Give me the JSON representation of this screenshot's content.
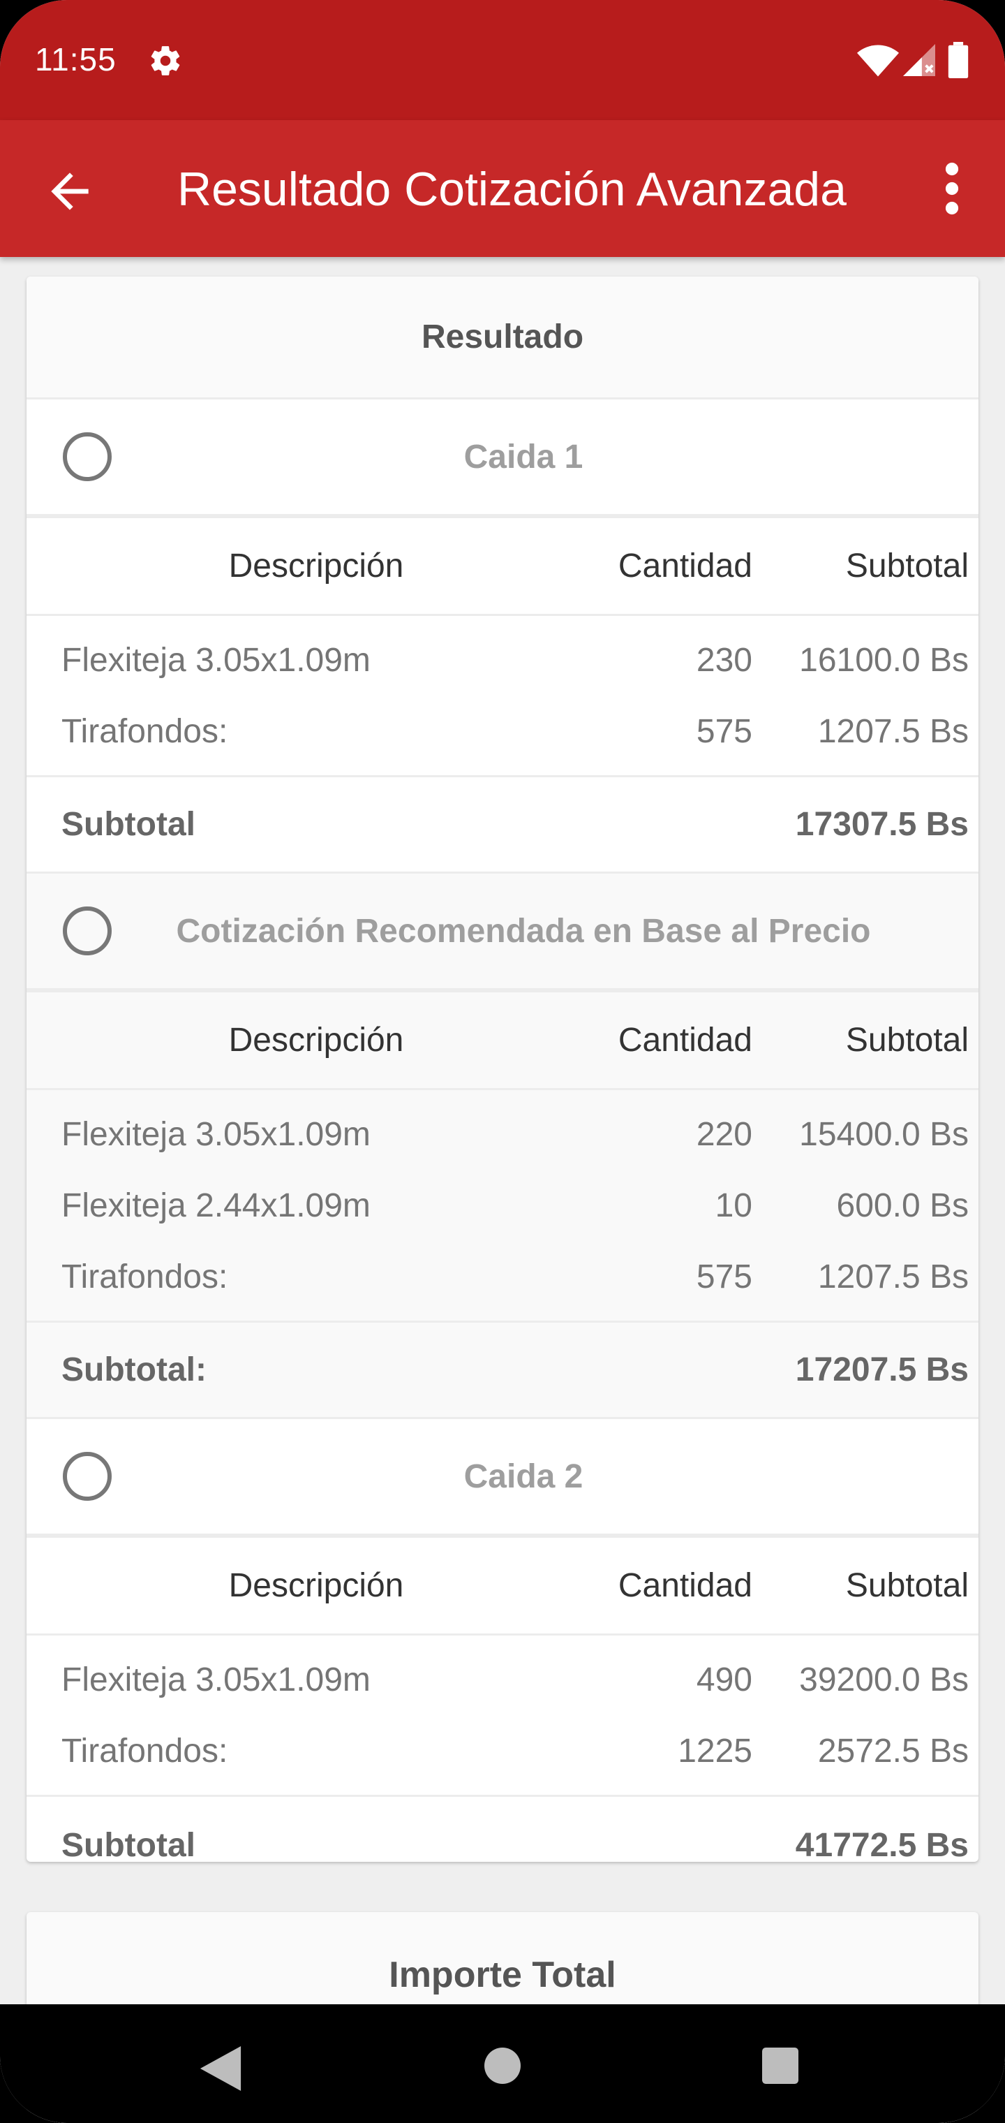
{
  "status_bar": {
    "time": "11:55"
  },
  "app_bar": {
    "title": "Resultado Cotización Avanzada"
  },
  "result_card": {
    "header": "Resultado",
    "sections": [
      {
        "option_label": "Caida 1",
        "columns": {
          "desc": "Descripción",
          "qty": "Cantidad",
          "subtotal": "Subtotal"
        },
        "rows": [
          {
            "desc": "Flexiteja 3.05x1.09m",
            "qty": "230",
            "subtotal": "16100.0 Bs"
          },
          {
            "desc": "Tirafondos:",
            "qty": "575",
            "subtotal": "1207.5 Bs"
          }
        ],
        "subtotal_label": "Subtotal",
        "subtotal_value": "17307.5 Bs"
      },
      {
        "option_label": "Cotización Recomendada en Base al Precio",
        "columns": {
          "desc": "Descripción",
          "qty": "Cantidad",
          "subtotal": "Subtotal"
        },
        "rows": [
          {
            "desc": "Flexiteja 3.05x1.09m",
            "qty": "220",
            "subtotal": "15400.0 Bs"
          },
          {
            "desc": "Flexiteja 2.44x1.09m",
            "qty": "10",
            "subtotal": "600.0 Bs"
          },
          {
            "desc": "Tirafondos:",
            "qty": "575",
            "subtotal": "1207.5 Bs"
          }
        ],
        "subtotal_label": "Subtotal:",
        "subtotal_value": "17207.5 Bs"
      },
      {
        "option_label": "Caida 2",
        "columns": {
          "desc": "Descripción",
          "qty": "Cantidad",
          "subtotal": "Subtotal"
        },
        "rows": [
          {
            "desc": "Flexiteja 3.05x1.09m",
            "qty": "490",
            "subtotal": "39200.0 Bs"
          },
          {
            "desc": "Tirafondos:",
            "qty": "1225",
            "subtotal": "2572.5 Bs"
          }
        ],
        "subtotal_label": "Subtotal",
        "subtotal_value": "41772.5 Bs"
      }
    ]
  },
  "total_card": {
    "title": "Importe Total"
  },
  "colors": {
    "status_bar": "#b71c1c",
    "app_bar": "#c62828",
    "background": "#efefef"
  },
  "icons": {
    "status": [
      "gear-icon",
      "wifi-icon",
      "signal-icon",
      "battery-icon"
    ],
    "app_bar": [
      "back-arrow-icon",
      "more-vert-icon"
    ],
    "nav": [
      "nav-back-icon",
      "nav-home-icon",
      "nav-recents-icon"
    ]
  }
}
